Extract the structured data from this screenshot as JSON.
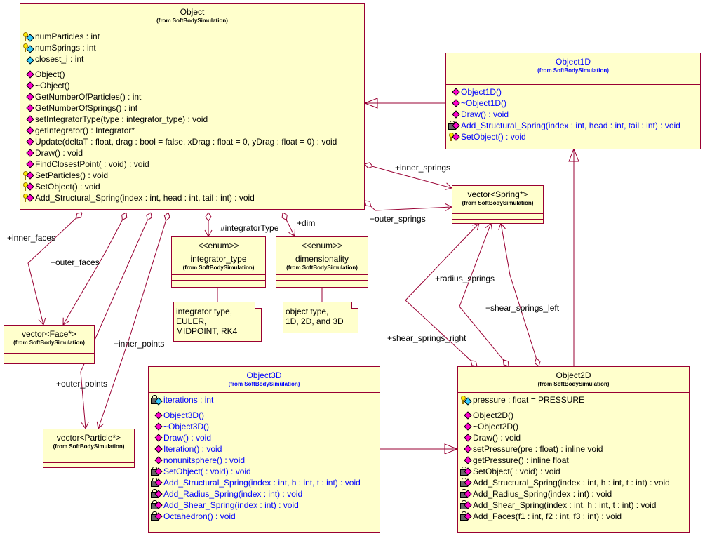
{
  "colors": {
    "fill": "#ffffcc",
    "border": "#990033",
    "blue_text": "#0000ff",
    "public_op": "#ff00cc",
    "attribute": "#33ccff"
  },
  "classes": [
    {
      "id": "object",
      "name": "Object",
      "package": "(from SoftBodySimulation)",
      "color": "#000000",
      "attributes": [
        {
          "icon": "key",
          "text": "numParticles : int"
        },
        {
          "icon": "key",
          "text": "numSprings : int"
        },
        {
          "icon": "public",
          "text": "closest_i : int"
        }
      ],
      "operations": [
        {
          "icon": "public",
          "text": "Object()"
        },
        {
          "icon": "public",
          "text": "~Object()"
        },
        {
          "icon": "public",
          "text": "GetNumberOfParticles() : int"
        },
        {
          "icon": "public",
          "text": "GetNumberOfSprings() : int"
        },
        {
          "icon": "public",
          "text": "setIntegratorType(type : integrator_type) : void"
        },
        {
          "icon": "public",
          "text": "getIntegrator() : Integrator*"
        },
        {
          "icon": "public",
          "text": "Update(deltaT : float, drag : bool = false, xDrag : float = 0, yDrag : float = 0) : void"
        },
        {
          "icon": "public",
          "text": "Draw() : void"
        },
        {
          "icon": "public",
          "text": "FindClosestPoint( : void) : void"
        },
        {
          "icon": "key",
          "text": "SetParticles() : void"
        },
        {
          "icon": "key",
          "text": "SetObject() : void"
        },
        {
          "icon": "key",
          "text": "Add_Structural_Spring(index : int, head : int, tail : int) : void"
        }
      ]
    },
    {
      "id": "object1d",
      "name": "Object1D",
      "package": "(from SoftBodySimulation)",
      "color": "#0000ff",
      "attributes": [],
      "operations": [
        {
          "icon": "public",
          "text": "Object1D()"
        },
        {
          "icon": "public",
          "text": "~Object1D()"
        },
        {
          "icon": "public",
          "text": "Draw() : void"
        },
        {
          "icon": "lock",
          "text": "Add_Structural_Spring(index : int, head : int, tail : int) : void"
        },
        {
          "icon": "key",
          "text": "SetObject() : void"
        }
      ]
    },
    {
      "id": "vspring",
      "name": "vector<Spring*>",
      "package": "(from SoftBodySimulation)",
      "color": "#000000",
      "attributes": [],
      "operations": []
    },
    {
      "id": "integrator",
      "name": "<<enum>>",
      "name2": "integrator_type",
      "package": "(from SoftBodySimulation)",
      "color": "#000000",
      "attributes": [],
      "operations": []
    },
    {
      "id": "dim",
      "name": "<<enum>>",
      "name2": "dimensionality",
      "package": "(from SoftBodySimulation)",
      "color": "#000000",
      "attributes": [],
      "operations": []
    },
    {
      "id": "vface",
      "name": "vector<Face*>",
      "package": "(from SoftBodySimulation)",
      "color": "#000000",
      "attributes": [],
      "operations": []
    },
    {
      "id": "vparticle",
      "name": "vector<Particle*>",
      "package": "(from SoftBodySimulation)",
      "color": "#000000",
      "attributes": [],
      "operations": []
    },
    {
      "id": "object3d",
      "name": "Object3D",
      "package": "(from SoftBodySimulation)",
      "color": "#0000ff",
      "attributes": [
        {
          "icon": "lock",
          "text": "iterations : int"
        }
      ],
      "operations": [
        {
          "icon": "public",
          "text": "Object3D()"
        },
        {
          "icon": "public",
          "text": "~Object3D()"
        },
        {
          "icon": "public",
          "text": "Draw() : void"
        },
        {
          "icon": "public",
          "text": "Iteration() : void"
        },
        {
          "icon": "public",
          "text": "nonunitsphere() : void"
        },
        {
          "icon": "lock",
          "text": "SetObject( : void) : void"
        },
        {
          "icon": "lock",
          "text": "Add_Structural_Spring(index : int, h : int, t : int) : void"
        },
        {
          "icon": "lock",
          "text": "Add_Radius_Spring(index : int) : void"
        },
        {
          "icon": "lock",
          "text": "Add_Shear_Spring(index : int) : void"
        },
        {
          "icon": "lock",
          "text": "Octahedron() : void"
        }
      ]
    },
    {
      "id": "object2d",
      "name": "Object2D",
      "package": "(from SoftBodySimulation)",
      "color": "#000000",
      "attributes": [
        {
          "icon": "key",
          "text": "pressure : float = PRESSURE"
        }
      ],
      "operations": [
        {
          "icon": "public",
          "text": "Object2D()"
        },
        {
          "icon": "public",
          "text": "~Object2D()"
        },
        {
          "icon": "public",
          "text": "Draw() : void"
        },
        {
          "icon": "public",
          "text": "setPressure(pre : float) : inline void"
        },
        {
          "icon": "public",
          "text": "getPressure() : inline float"
        },
        {
          "icon": "lock",
          "text": "SetObject( : void) : void"
        },
        {
          "icon": "lock",
          "text": "Add_Structural_Spring(index : int, h : int, t : int) : void"
        },
        {
          "icon": "lock",
          "text": "Add_Radius_Spring(index : int) : void"
        },
        {
          "icon": "lock",
          "text": "Add_Shear_Spring(index : int, h : int, t : int) : void"
        },
        {
          "icon": "lock",
          "text": "Add_Faces(f1 : int, f2 : int, f3 : int) : void"
        }
      ]
    }
  ],
  "notes": {
    "integrator": "integrator type,\nEULER,\nMIDPOINT, RK4",
    "dim": "object type,\n1D, 2D, and 3D"
  },
  "labels": {
    "inner_springs": "+inner_springs",
    "outer_springs": "+outer_springs",
    "inner_faces": "+inner_faces",
    "outer_faces": "+outer_faces",
    "inner_points": "+inner_points",
    "outer_points": "+outer_points",
    "integratorType": "#integratorType",
    "dim": "+dim",
    "radius_springs": "+radius_springs",
    "shear_springs_left": "+shear_springs_left",
    "shear_springs_right": "+shear_springs_right"
  }
}
